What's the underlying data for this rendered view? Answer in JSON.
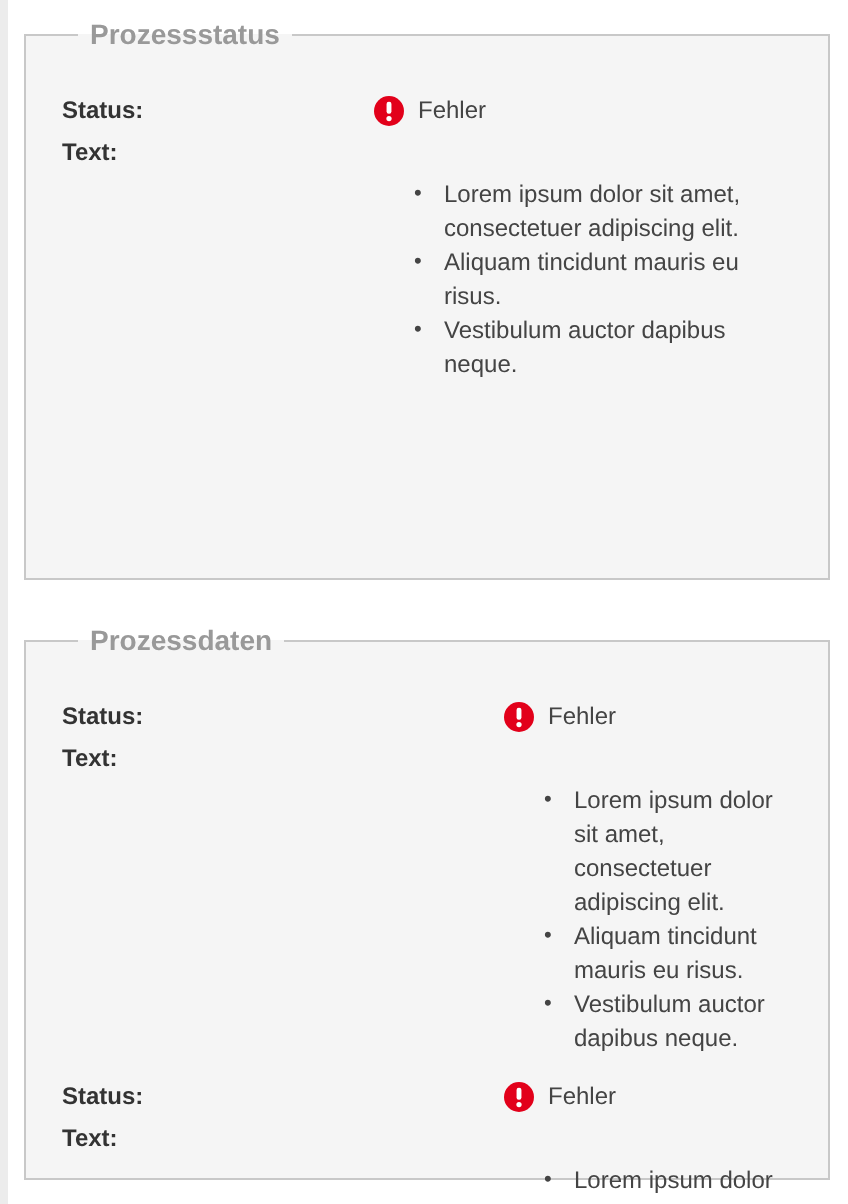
{
  "panels": [
    {
      "title": "Prozessstatus",
      "entries": [
        {
          "status_label": "Status:",
          "status": {
            "kind": "error",
            "text": "Fehler"
          },
          "text_label": "Text:",
          "items": [
            {
              "bullet": "•",
              "text": "Lorem ipsum dolor sit amet, consectetuer adipiscing elit."
            },
            {
              "bullet": "•",
              "text": "Aliquam tincidunt mauris eu risus."
            },
            {
              "bullet": "•",
              "text": "Vestibulum auctor dapibus neque."
            }
          ]
        }
      ]
    },
    {
      "title": "Prozessdaten",
      "entries": [
        {
          "status_label": "Status:",
          "status": {
            "kind": "error",
            "text": "Fehler"
          },
          "text_label": "Text:",
          "items": [
            {
              "bullet": "•",
              "text": "Lorem ipsum dolor sit amet, consectetuer adipiscing elit."
            },
            {
              "bullet": "•",
              "text": "Aliquam tincidunt mauris eu risus."
            },
            {
              "bullet": "•",
              "text": "Vestibulum auctor dapibus neque."
            }
          ]
        },
        {
          "status_label": "Status:",
          "status": {
            "kind": "error",
            "text": "Fehler"
          },
          "text_label": "Text:",
          "items": [
            {
              "bullet": "•",
              "text": "Lorem ipsum dolor"
            }
          ]
        }
      ]
    }
  ]
}
